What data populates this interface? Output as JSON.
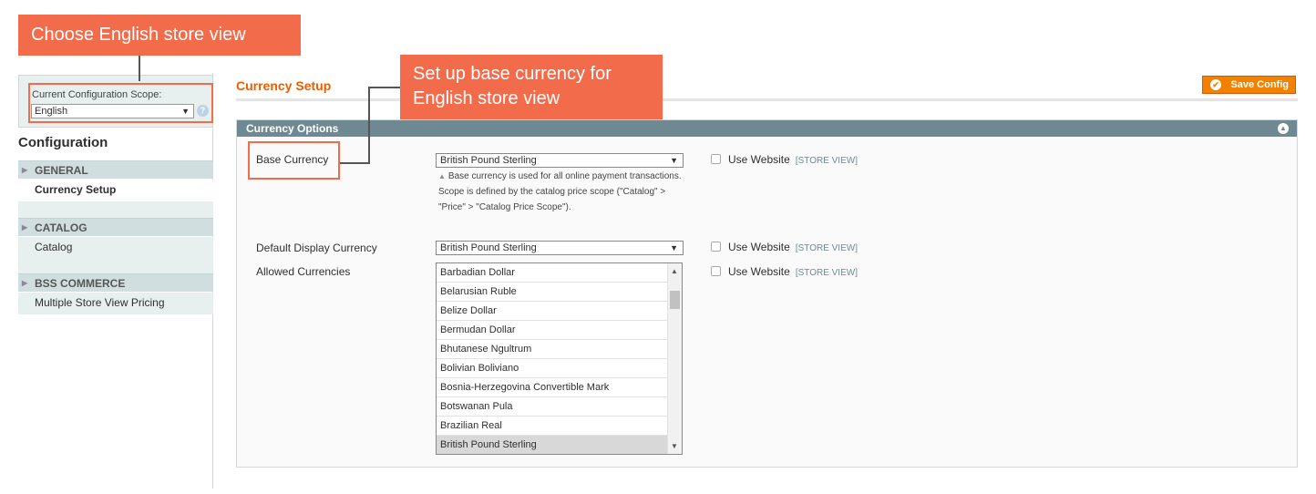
{
  "scope": {
    "label": "Current Configuration Scope:",
    "value": "English",
    "help_icon": "question-mark"
  },
  "sidebar": {
    "title": "Configuration",
    "sections": [
      {
        "label": "GENERAL",
        "items": [
          {
            "label": "Currency Setup",
            "active": true
          }
        ]
      },
      {
        "label": "CATALOG",
        "items": [
          {
            "label": "Catalog",
            "active": false
          }
        ]
      },
      {
        "label": "BSS COMMERCE",
        "items": [
          {
            "label": "Multiple Store View Pricing",
            "active": false
          }
        ]
      }
    ]
  },
  "header": {
    "title": "Currency Setup",
    "save_label": "Save Config"
  },
  "fieldset": {
    "title": "Currency Options",
    "base_currency": {
      "label": "Base Currency",
      "value": "British Pound Sterling",
      "note": "Base currency is used for all online payment transactions. Scope is defined by the catalog price scope (\"Catalog\" > \"Price\" > \"Catalog Price Scope\").",
      "use_website": "Use Website",
      "scope": "[STORE VIEW]"
    },
    "default_display": {
      "label": "Default Display Currency",
      "value": "British Pound Sterling",
      "use_website": "Use Website",
      "scope": "[STORE VIEW]"
    },
    "allowed": {
      "label": "Allowed Currencies",
      "use_website": "Use Website",
      "scope": "[STORE VIEW]",
      "options": [
        "Barbadian Dollar",
        "Belarusian Ruble",
        "Belize Dollar",
        "Bermudan Dollar",
        "Bhutanese Ngultrum",
        "Bolivian Boliviano",
        "Bosnia-Herzegovina Convertible Mark",
        "Botswanan Pula",
        "Brazilian Real",
        "British Pound Sterling"
      ],
      "selected": "British Pound Sterling"
    }
  },
  "annotations": {
    "callout_scope": "Choose English store view",
    "callout_base_line1": "Set up base currency for",
    "callout_base_line2": "English store view",
    "color": "#f26b4a"
  },
  "colors": {
    "accent": "#eb5e00",
    "button": "#f18200",
    "fieldset_header": "#6f8992",
    "sidebar_bg": "#e7efef"
  }
}
